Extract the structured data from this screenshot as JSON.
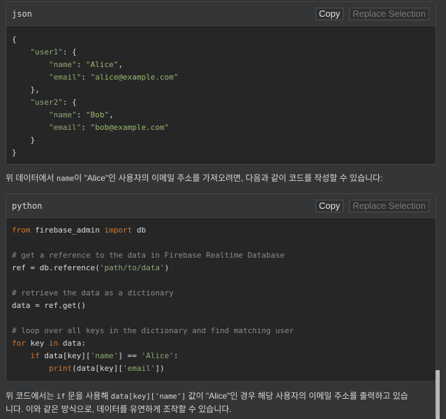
{
  "json_block": {
    "lang": "json",
    "copy_label": "Copy",
    "replace_label": "Replace Selection",
    "lines": [
      [
        [
          "p",
          "{"
        ]
      ],
      [
        [
          "p",
          "    "
        ],
        [
          "s",
          "\"user1\""
        ],
        [
          "p",
          ": {"
        ]
      ],
      [
        [
          "p",
          "        "
        ],
        [
          "s",
          "\"name\""
        ],
        [
          "p",
          ": "
        ],
        [
          "v",
          "\"Alice\""
        ],
        [
          "p",
          ","
        ]
      ],
      [
        [
          "p",
          "        "
        ],
        [
          "s",
          "\"email\""
        ],
        [
          "p",
          ": "
        ],
        [
          "v",
          "\"alice@example.com\""
        ]
      ],
      [
        [
          "p",
          "    },"
        ]
      ],
      [
        [
          "p",
          "    "
        ],
        [
          "s",
          "\"user2\""
        ],
        [
          "p",
          ": {"
        ]
      ],
      [
        [
          "p",
          "        "
        ],
        [
          "s",
          "\"name\""
        ],
        [
          "p",
          ": "
        ],
        [
          "v",
          "\"Bob\""
        ],
        [
          "p",
          ","
        ]
      ],
      [
        [
          "p",
          "        "
        ],
        [
          "s",
          "\"email\""
        ],
        [
          "p",
          ": "
        ],
        [
          "v",
          "\"bob@example.com\""
        ]
      ],
      [
        [
          "p",
          "    }"
        ]
      ],
      [
        [
          "p",
          "}"
        ]
      ]
    ]
  },
  "paragraph1": {
    "before": "위 데이터에서 ",
    "code": "name",
    "after": "이 \"Alice\"인 사용자의 이메일 주소를 가져오려면, 다음과 같이 코드를 작성할 수 있습니다:"
  },
  "python_block": {
    "lang": "python",
    "copy_label": "Copy",
    "replace_label": "Replace Selection",
    "lines": [
      [
        [
          "k",
          "from"
        ],
        [
          "p",
          " firebase_admin "
        ],
        [
          "k",
          "import"
        ],
        [
          "p",
          " db"
        ]
      ],
      [
        [
          "p",
          ""
        ]
      ],
      [
        [
          "c",
          "# get a reference to the data in Firebase Realtime Database"
        ]
      ],
      [
        [
          "p",
          "ref = db.reference("
        ],
        [
          "s",
          "'path/to/data'"
        ],
        [
          "p",
          ")"
        ]
      ],
      [
        [
          "p",
          ""
        ]
      ],
      [
        [
          "c",
          "# retrieve the data as a dictionary"
        ]
      ],
      [
        [
          "p",
          "data = ref.get()"
        ]
      ],
      [
        [
          "p",
          ""
        ]
      ],
      [
        [
          "c",
          "# loop over all keys in the dictionary and find matching user"
        ]
      ],
      [
        [
          "k",
          "for"
        ],
        [
          "p",
          " key "
        ],
        [
          "k",
          "in"
        ],
        [
          "p",
          " data:"
        ]
      ],
      [
        [
          "p",
          "    "
        ],
        [
          "k",
          "if"
        ],
        [
          "p",
          " data[key]["
        ],
        [
          "s",
          "'name'"
        ],
        [
          "p",
          "] == "
        ],
        [
          "s",
          "'Alice'"
        ],
        [
          "p",
          ":"
        ]
      ],
      [
        [
          "p",
          "        "
        ],
        [
          "k",
          "print"
        ],
        [
          "p",
          "(data[key]["
        ],
        [
          "s",
          "'email'"
        ],
        [
          "p",
          "])"
        ]
      ]
    ]
  },
  "paragraph2": {
    "line1_a": "위 코드에서는 ",
    "line1_code1": "if",
    "line1_b": " 문을 사용해 ",
    "line1_code2": "data[key]['name']",
    "line1_c": " 값이 \"Alice\"인 경우 해당 사용자의 이메일 주소를 출력하고 있습",
    "line2": "니다. 이와 같은 방식으로, 데이터를 유연하게 조작할 수 있습니다."
  }
}
